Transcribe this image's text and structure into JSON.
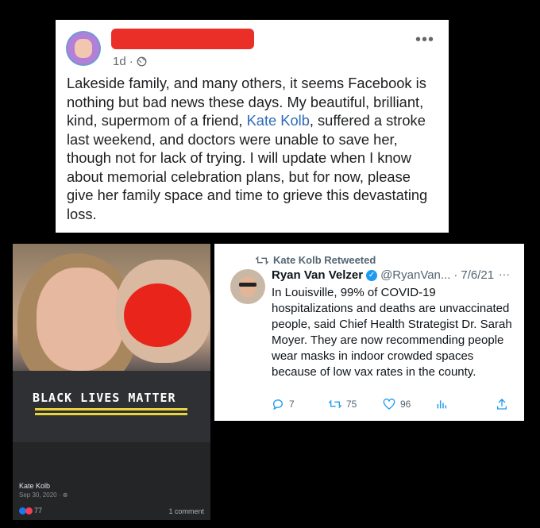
{
  "facebook_post": {
    "time": "1d",
    "text_before_link": "Lakeside family, and many others, it seems Facebook is nothing but bad news these days. My beautiful, brilliant, kind, supermom of a friend, ",
    "link_text": "Kate Kolb",
    "text_after_link": ", suffered a stroke last weekend, and doctors were unable to save her, though not for lack of trying. I will update when I know about memorial celebration plans, but for now, please give her family space and time to grieve this devastating loss."
  },
  "photo_post": {
    "overlay_text": "BLACK LIVES MATTER",
    "author": "Kate Kolb",
    "date": "Sep 30, 2020",
    "reaction_count": "77",
    "comments": "1 comment"
  },
  "tweet": {
    "retweet_label": "Kate Kolb Retweeted",
    "name": "Ryan Van Velzer",
    "handle": "@RyanVan...",
    "separator": "·",
    "date": "7/6/21",
    "text": "In Louisville, 99% of COVID-19 hospitalizations and deaths are unvaccinated people, said Chief Health Strategist Dr. Sarah Moyer. They are now recommending people wear masks in indoor crowded spaces because of low vax rates in the county.",
    "replies": "7",
    "retweets": "75",
    "likes": "96"
  },
  "colors": {
    "link": "#2d6ab6",
    "redaction": "#e8241b",
    "verified": "#1d9bf0"
  }
}
